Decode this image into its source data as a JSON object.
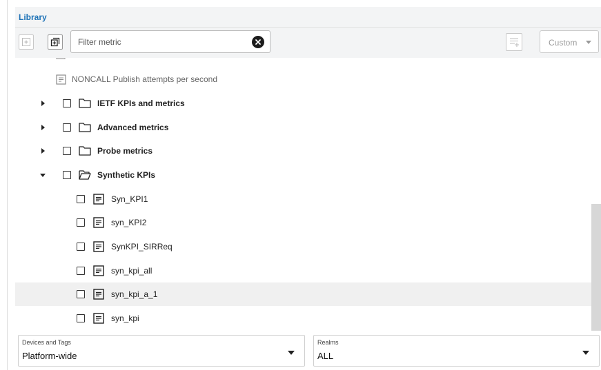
{
  "header": {
    "title": "Library"
  },
  "toolbar": {
    "filter_placeholder": "Filter metric",
    "custom_label": "Custom"
  },
  "tree": {
    "partial_item": "NONCALL Publish attempts per second",
    "folders": [
      {
        "label": "IETF KPIs and metrics",
        "expanded": false
      },
      {
        "label": "Advanced metrics",
        "expanded": false
      },
      {
        "label": "Probe metrics",
        "expanded": false
      },
      {
        "label": "Synthetic KPIs",
        "expanded": true
      }
    ],
    "kpis": [
      "Syn_KPI1",
      "syn_KPI2",
      "SynKPI_SIRReq",
      "syn_kpi_all",
      "syn_kpi_a_1",
      "syn_kpi"
    ]
  },
  "footer": {
    "devices": {
      "caption": "Devices and Tags",
      "value": "Platform-wide"
    },
    "realms": {
      "caption": "Realms",
      "value": "ALL"
    }
  },
  "colors": {
    "accent": "#1f73b7",
    "panel": "#f3f4f5",
    "hover_row": "#f0f0f0",
    "scroll_thumb": "#d7d7d7"
  }
}
